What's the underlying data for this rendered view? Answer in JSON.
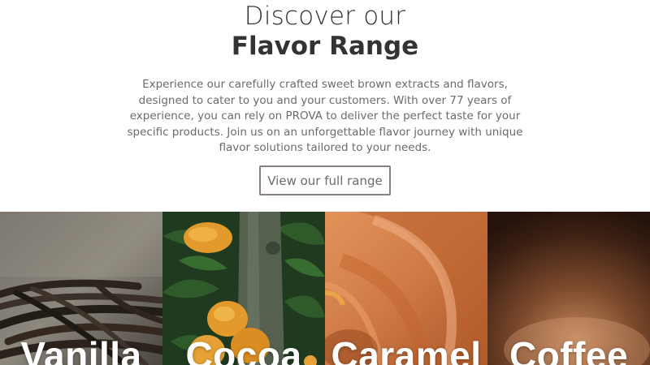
{
  "hero": {
    "title_line1": "Discover our",
    "title_line2": "Flavor Range",
    "intro": "Experience our carefully crafted sweet brown extracts and flavors, designed to cater to you and your customers. With over 77 years of experience, you can rely on PROVA to deliver the perfect taste for your specific products. Join us on an unforgettable flavor journey with unique flavor solutions tailored to your needs.",
    "cta_label": "View our full range"
  },
  "tiles": [
    {
      "label": "Vanilla"
    },
    {
      "label": "Cocoa"
    },
    {
      "label": "Caramel"
    },
    {
      "label": "Coffee"
    }
  ],
  "colors": {
    "heading": "#333333",
    "body_text": "#6b6b6b",
    "button_border": "#8c7f80",
    "tile_label": "#ffffff"
  }
}
